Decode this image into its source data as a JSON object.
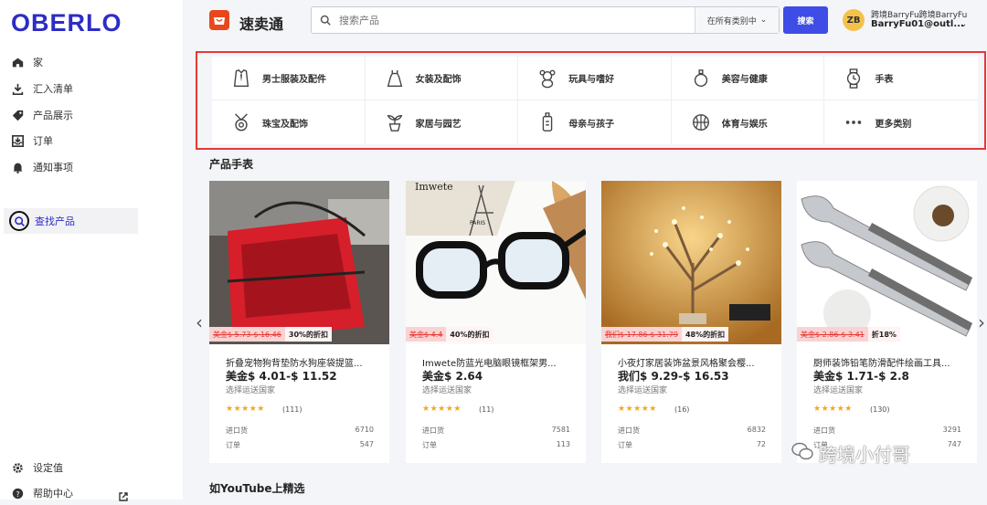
{
  "app": {
    "logo": "OBERLO",
    "brand": "速卖通",
    "brand_icon": "aliexpress-icon"
  },
  "colors": {
    "brand": "#2d2cc7",
    "accent": "#3d4de6",
    "highlight": "#e53935",
    "star": "#f5a623"
  },
  "sidebar": {
    "items": [
      {
        "label": "家",
        "icon": "home-icon"
      },
      {
        "label": "汇入清单",
        "icon": "import-icon"
      },
      {
        "label": "产品展示",
        "icon": "tag-icon"
      },
      {
        "label": "订单",
        "icon": "inbox-icon"
      },
      {
        "label": "通知事项",
        "icon": "bell-icon"
      },
      {
        "label": "查找产品",
        "icon": "search-icon",
        "active": true
      }
    ],
    "bottom": [
      {
        "label": "设定值",
        "icon": "gear-icon"
      },
      {
        "label": "帮助中心",
        "icon": "help-icon"
      }
    ]
  },
  "search": {
    "placeholder": "搜索产品",
    "scope": "在所有类别中",
    "button": "搜索"
  },
  "user": {
    "initials": "ZB",
    "name": "跨境BarryFu跨境BarryFu",
    "email": "BarryFu01@outl..."
  },
  "categories": [
    {
      "label": "男士服装及配件",
      "icon": "shirt-tie-icon"
    },
    {
      "label": "女装及配饰",
      "icon": "dress-icon"
    },
    {
      "label": "玩具与嗜好",
      "icon": "teddy-bear-icon"
    },
    {
      "label": "美容与健康",
      "icon": "perfume-icon"
    },
    {
      "label": "手表",
      "icon": "watch-icon"
    },
    {
      "label": "珠宝及配饰",
      "icon": "necklace-icon"
    },
    {
      "label": "家居与园艺",
      "icon": "plant-pot-icon"
    },
    {
      "label": "母亲与孩子",
      "icon": "baby-bottle-icon"
    },
    {
      "label": "体育与娱乐",
      "icon": "basketball-icon"
    },
    {
      "label": "更多类别",
      "icon": "more-icon"
    }
  ],
  "section1": "产品手表",
  "section2": "如YouTube上精选",
  "products": [
    {
      "old_price": "美金$ 5.73-$ 16.46",
      "discount": "30%的折扣",
      "title": "折叠宠物狗背垫防水狗座袋提篮...",
      "price": "美金$ 4.01-$ 11.52",
      "ship": "选择运送国家",
      "stars": "★★★★★",
      "reviews": "(111)",
      "import_label": "进口货",
      "import_count": "6710",
      "order_label": "订单",
      "order_count": "547"
    },
    {
      "old_price": "美金$ 4.4",
      "discount": "40%的折扣",
      "title": "Imwete防蓝光电脑眼镜框架男...",
      "price": "美金$ 2.64",
      "ship": "选择运送国家",
      "stars": "★★★★★",
      "reviews": "(11)",
      "import_label": "进口货",
      "import_count": "7581",
      "order_label": "订单",
      "order_count": "113"
    },
    {
      "old_price": "我们$ 17.86-$ 31.79",
      "discount": "48%的折扣",
      "title": "小夜灯家居装饰盆景风格聚会樱...",
      "price": "我们$ 9.29-$ 16.53",
      "ship": "选择运送国家",
      "stars": "★★★★★",
      "reviews": "(16)",
      "import_label": "进口货",
      "import_count": "6832",
      "order_label": "订单",
      "order_count": "72"
    },
    {
      "old_price": "美金$ 2.86-$ 3.41",
      "discount": "折18%",
      "title": "厨师装饰铅笔防滑配件绘画工具...",
      "price": "美金$ 1.71-$ 2.8",
      "ship": "选择运送国家",
      "stars": "★★★★★",
      "reviews": "(130)",
      "import_label": "进口货",
      "import_count": "3291",
      "order_label": "订单",
      "order_count": "747"
    }
  ],
  "watermark": "跨境小付哥"
}
